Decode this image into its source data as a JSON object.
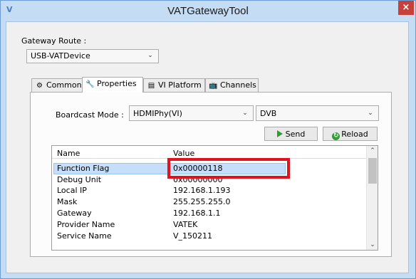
{
  "window": {
    "title": "VATGatewayTool",
    "app_icon": "vat-app-icon",
    "close_label": "×"
  },
  "gateway": {
    "route_label": "Gateway Route :",
    "route_value": "USB-VATDevice"
  },
  "tabs": [
    {
      "label": "Common",
      "icon": "gear-icon",
      "active": false
    },
    {
      "label": "Properties",
      "icon": "wrench-icon",
      "active": true
    },
    {
      "label": "VI Platform",
      "icon": "grid-icon",
      "active": false
    },
    {
      "label": "Channels",
      "icon": "tv-icon",
      "active": false
    }
  ],
  "properties": {
    "broadcast_label": "Boardcast Mode :",
    "broadcast_value": "HDMIPhy(VI)",
    "standard_value": "DVB",
    "send_label": "Send",
    "reload_label": "Reload",
    "columns": [
      "Name",
      "Value"
    ],
    "rows": [
      {
        "name": "Function Flag",
        "value": "0x00000118",
        "selected": true
      },
      {
        "name": "Debug Unit",
        "value": "0x00000000",
        "selected": false
      },
      {
        "name": "Local IP",
        "value": "192.168.1.193",
        "selected": false
      },
      {
        "name": "Mask",
        "value": "255.255.255.0",
        "selected": false
      },
      {
        "name": "Gateway",
        "value": "192.168.1.1",
        "selected": false
      },
      {
        "name": "Provider Name",
        "value": "VATEK",
        "selected": false
      },
      {
        "name": "Service Name",
        "value": "V_150211",
        "selected": false
      }
    ]
  },
  "colors": {
    "titlebar": "#c5dcf5",
    "close": "#c7403a",
    "selection": "#c5dffa",
    "highlight": "#e0141e"
  }
}
